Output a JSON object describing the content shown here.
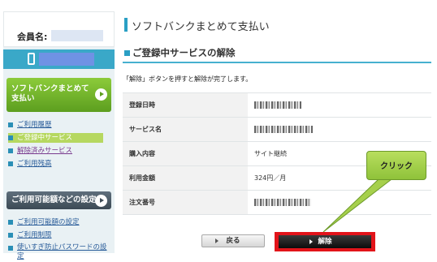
{
  "sidebar": {
    "member_label": "会員名:",
    "main_button": "ソフトバンクまとめて支払い",
    "menu1": [
      {
        "label": "ご利用履歴"
      },
      {
        "label": "ご登録中サービス"
      },
      {
        "label": "解除済みサービス"
      },
      {
        "label": "ご利用残高"
      }
    ],
    "section2_button": "ご利用可能額などの設定",
    "menu2": [
      {
        "label": "ご利用可能額の設定"
      },
      {
        "label": "ご利用制限"
      },
      {
        "label": "使いすぎ防止パスワードの設定"
      }
    ]
  },
  "main": {
    "title": "ソフトバンクまとめて支払い",
    "section_title": "ご登録中サービスの解除",
    "notice": "「解除」ボタンを押すと解除が完了します。",
    "rows": [
      {
        "label": "登録日時",
        "value": ""
      },
      {
        "label": "サービス名",
        "value": ""
      },
      {
        "label": "購入内容",
        "value": "サイト継続"
      },
      {
        "label": "利用金額",
        "value": "324円／月"
      },
      {
        "label": "注文番号",
        "value": ""
      }
    ],
    "back_button": "戻る",
    "cancel_button": "解除",
    "callout": "クリック"
  },
  "colors": {
    "accent": "#2a9fc4",
    "highlight_red": "#e2141a",
    "callout_green": "#a6d04c"
  }
}
